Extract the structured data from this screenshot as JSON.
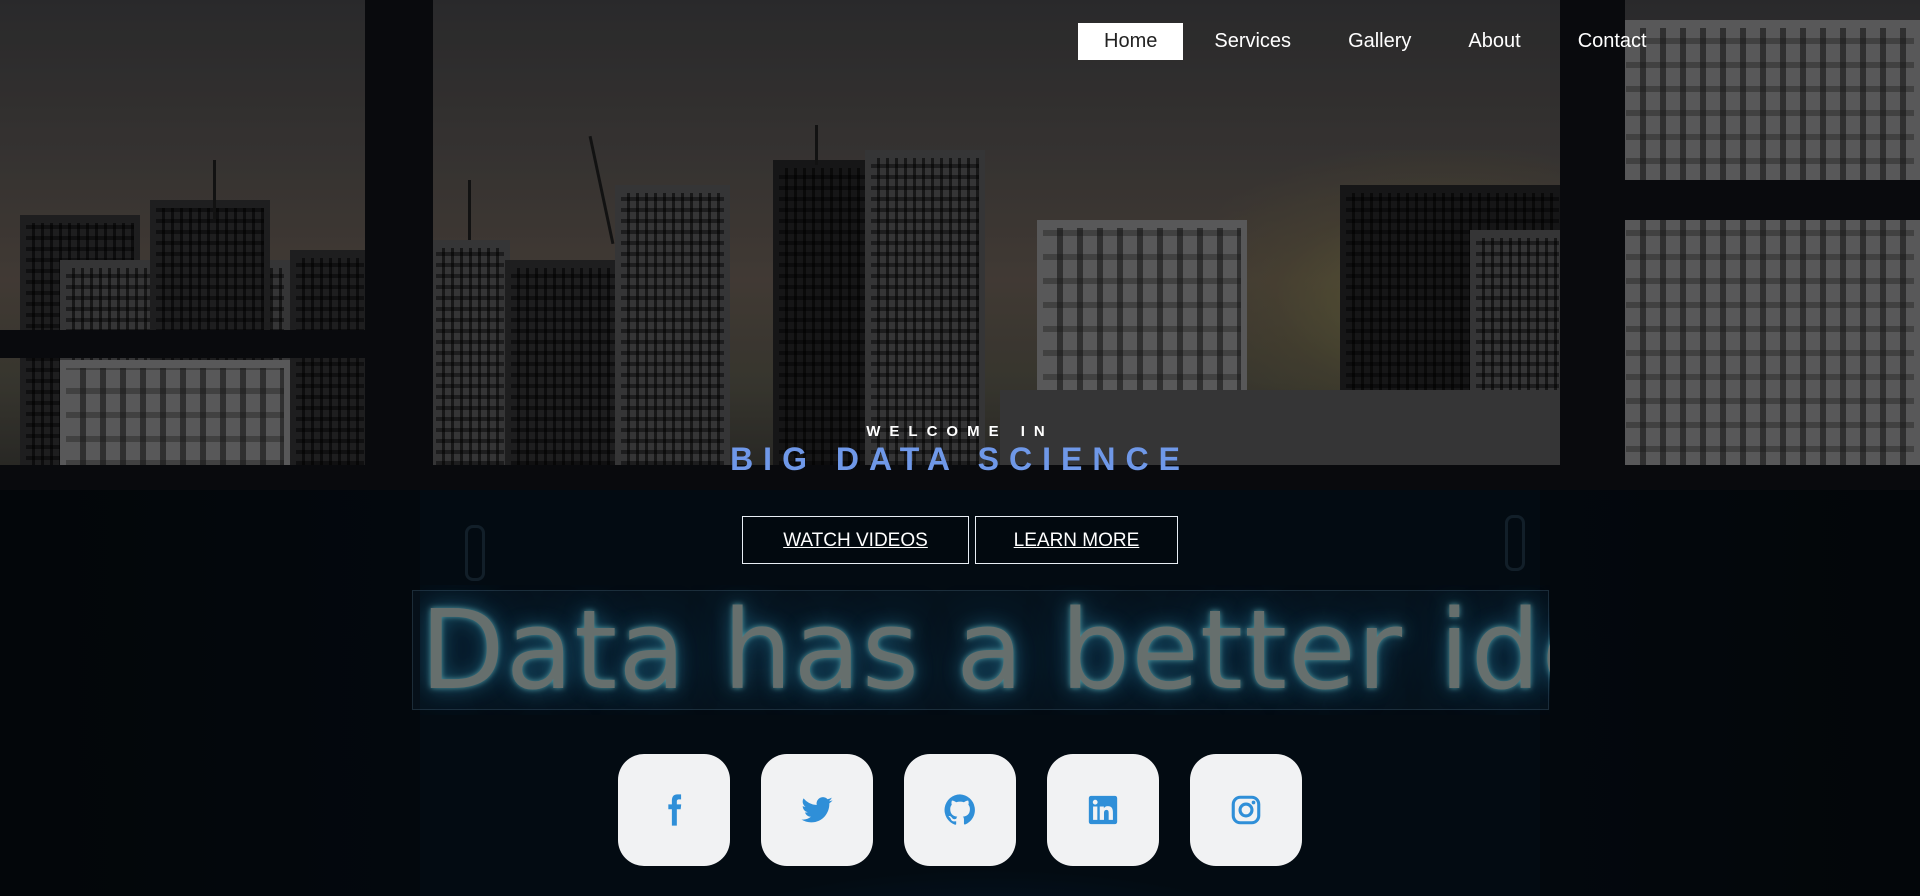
{
  "nav": {
    "items": [
      {
        "label": "Home",
        "active": true
      },
      {
        "label": "Services",
        "active": false
      },
      {
        "label": "Gallery",
        "active": false
      },
      {
        "label": "About",
        "active": false
      },
      {
        "label": "Contact",
        "active": false
      }
    ]
  },
  "hero": {
    "eyebrow": "WELCOME IN",
    "title": "BIG DATA SCIENCE",
    "title_color": "#6f98e8",
    "neon_sign": "Data has a better idea"
  },
  "buttons": {
    "watch_videos": "WATCH VIDEOS",
    "learn_more": "LEARN MORE"
  },
  "social": {
    "icon_color": "#2f8fd8",
    "links": [
      {
        "icon": "facebook-icon"
      },
      {
        "icon": "twitter-icon"
      },
      {
        "icon": "github-icon"
      },
      {
        "icon": "linkedin-icon"
      },
      {
        "icon": "instagram-icon"
      }
    ]
  }
}
